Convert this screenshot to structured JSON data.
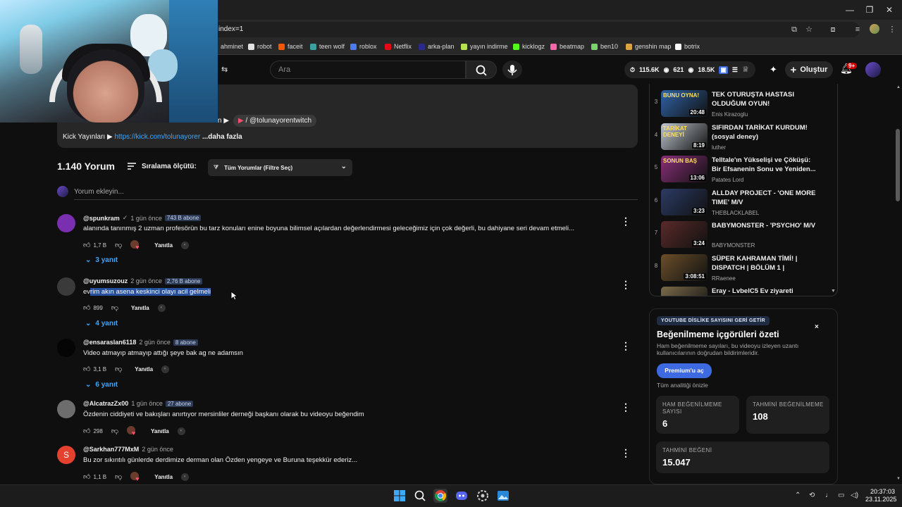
{
  "browser": {
    "address": "index=1",
    "bookmarks": [
      {
        "label": "ahminet",
        "color": "#c7c7c7"
      },
      {
        "label": "robot",
        "color": "#e2e2e2"
      },
      {
        "label": "faceit",
        "color": "#ff5500"
      },
      {
        "label": "teen wolf",
        "color": "#3aa0a0"
      },
      {
        "label": "roblox",
        "color": "#4b7bec"
      },
      {
        "label": "Netflix",
        "color": "#e50914"
      },
      {
        "label": "arka-plan",
        "color": "#2a2a8a"
      },
      {
        "label": "yayın indirme",
        "color": "#b7e34c"
      },
      {
        "label": "kicklogz",
        "color": "#53fc18"
      },
      {
        "label": "beatmap",
        "color": "#ff66aa"
      },
      {
        "label": "ben10",
        "color": "#7ad36b"
      },
      {
        "label": "genshin map",
        "color": "#d9a441"
      },
      {
        "label": "botrix",
        "color": "#ffffff"
      }
    ]
  },
  "masthead": {
    "search_placeholder": "Ara",
    "stats": [
      "115.6K",
      "621",
      "18.5K"
    ],
    "create_label": "Oluştur",
    "notif_count": "9+"
  },
  "description": {
    "line1_prefix": "n ▶",
    "twitch_handle": "/ @tolunayorentwitch",
    "line2_label": "Kick Yayınları ▶",
    "line2_link": "https://kick.com/tolunayorer",
    "line2_more": "...daha fazla"
  },
  "comments_header": {
    "count": "1.140 Yorum",
    "sort_label": "Sıralama ölçütü:",
    "filter_label": "Tüm Yorumlar (Filtre Seç)",
    "add_placeholder": "Yorum ekleyin..."
  },
  "comments": [
    {
      "author": "@spunkram",
      "verified": "✓",
      "time": "1 gün önce",
      "subs": "743 B abone",
      "text": "alanında tanınmış 2 uzman profesörün bu tarz konuları enine boyuna bilimsel açılardan değerlendirmesi geleceğimiz için çok değerli, bu dahiyane seri devam etmeli...",
      "text_pre": "",
      "text_hl": "",
      "likes": "1,7 B",
      "reply_label": "Yanıtla",
      "replies": "3 yanıt",
      "avatar_color": "#7a2fb0"
    },
    {
      "author": "@uyumsuzouz",
      "verified": "",
      "time": "2 gün önce",
      "subs": "2,76 B abone",
      "text": "",
      "text_pre": "ev",
      "text_hl": "rim akın asena keskinci olayı acil gelmeli",
      "likes": "899",
      "reply_label": "Yanıtla",
      "replies": "4 yanıt",
      "avatar_color": "#3a3a3a"
    },
    {
      "author": "@ensaraslan6118",
      "verified": "",
      "time": "2 gün önce",
      "subs": "8 abone",
      "text": "Video atmayıp atmayıp attığı şeye bak ag ne adamsın",
      "text_pre": "",
      "text_hl": "",
      "likes": "3,1 B",
      "reply_label": "Yanıtla",
      "replies": "6 yanıt",
      "avatar_color": "#050505"
    },
    {
      "author": "@AlcatrazZx00",
      "verified": "",
      "time": "1 gün önce",
      "subs": "27 abone",
      "text": "Özdenin ciddiyeti ve bakışları anırtıyor mersinliler derneği başkanı olarak bu videoyu beğendim",
      "text_pre": "",
      "text_hl": "",
      "likes": "298",
      "reply_label": "Yanıtla",
      "replies": "",
      "avatar_color": "#6d6d6d"
    },
    {
      "author": "@Sarkhan777MxM",
      "verified": "",
      "time": "2 gün önce",
      "subs": "",
      "text": "Bu zor sıkıntılı günlerde derdimize derman olan Özden yengeye ve Buruna teşekkür ederiz...",
      "text_pre": "",
      "text_hl": "",
      "likes": "1,1 B",
      "reply_label": "Yanıtla",
      "replies": "",
      "avatar_color": "#e4412f",
      "avatar_letter": "S"
    }
  ],
  "recommendations": [
    {
      "index": "3",
      "title": "TEK OTURUŞTA HASTASI OLDUĞUM OYUN!",
      "channel": "Enis Kirazoglu",
      "duration": "20:48",
      "thumb": "#2f63a6",
      "thumb_text": "BUNU OYNA!"
    },
    {
      "index": "4",
      "title": "SIFIRDAN TARİKAT KURDUM! (sosyal deney)",
      "channel": "luther",
      "duration": "8:19",
      "thumb": "#bfc7d0",
      "thumb_text": "TARİKAT DENEYİ"
    },
    {
      "index": "5",
      "title": "Telltale'ın Yükselişi ve Çöküşü: Bir Efsanenin Sonu ve Yeniden...",
      "channel": "Patates Lord",
      "duration": "13:06",
      "thumb": "#8a2f7a",
      "thumb_text": "SONUN BAŞ"
    },
    {
      "index": "6",
      "title": "ALLDAY PROJECT - 'ONE MORE TIME' M/V",
      "channel": "THEBLACKLABEL",
      "duration": "3:23",
      "thumb": "#2c3b66",
      "thumb_text": ""
    },
    {
      "index": "7",
      "title": "BABYMONSTER - 'PSYCHO' M/V",
      "channel": "BABYMONSTER",
      "duration": "3:24",
      "thumb": "#5a2a2a",
      "thumb_text": ""
    },
    {
      "index": "8",
      "title": "SÜPER KAHRAMAN TİMİ! | DISPATCH | BÖLÜM 1 |",
      "channel": "RRaenee",
      "duration": "3:08:51",
      "thumb": "#6b4f2a",
      "thumb_text": ""
    },
    {
      "index": "",
      "title": "Eray - LvbelC5 Ev ziyareti",
      "channel": "",
      "duration": "",
      "thumb": "#7a6a4a",
      "thumb_text": ""
    }
  ],
  "dislike": {
    "badge": "YOUTUBE DİSLİKE SAYISINI GERİ GETİR",
    "close": "×",
    "heading": "Beğenilmeme içgörüleri özeti",
    "desc": "Ham beğenilmeme sayıları, bu videoyu izleyen uzantı kullanıcılarının doğrudan bildirimleridir.",
    "premium_btn": "Premium'u aç",
    "preview_link": "Tüm analitiği önizle",
    "stats": [
      {
        "label": "HAM BEĞENİLMEME SAYISI",
        "value": "6"
      },
      {
        "label": "TAHMİNİ BEĞENİLMEME",
        "value": "108"
      },
      {
        "label": "TAHMİNİ BEĞENİ",
        "value": "15.047"
      }
    ]
  },
  "taskbar": {
    "time": "20:37:03",
    "date": "23.11.2025"
  }
}
